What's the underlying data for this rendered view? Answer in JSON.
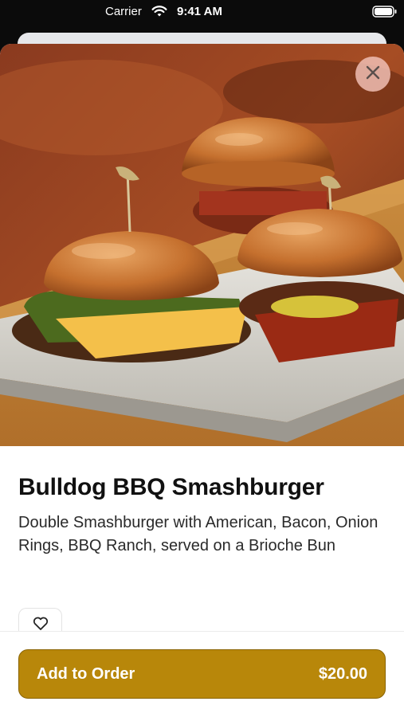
{
  "status_bar": {
    "carrier": "Carrier",
    "time": "9:41 AM",
    "icons": [
      "wifi-icon",
      "battery-icon"
    ]
  },
  "item": {
    "title": "Bulldog BBQ Smashburger",
    "description": "Double Smashburger with American, Bacon, Onion Rings, BBQ Ranch, served on a Brioche Bun",
    "image": "bbq-smashburger-sliders-photo"
  },
  "actions": {
    "close_icon": "close-icon",
    "favorite_icon": "heart-icon",
    "add_to_order_label": "Add to Order",
    "price": "$20.00"
  },
  "colors": {
    "accent": "#b8870a",
    "close_bg": "#f0beb4"
  }
}
